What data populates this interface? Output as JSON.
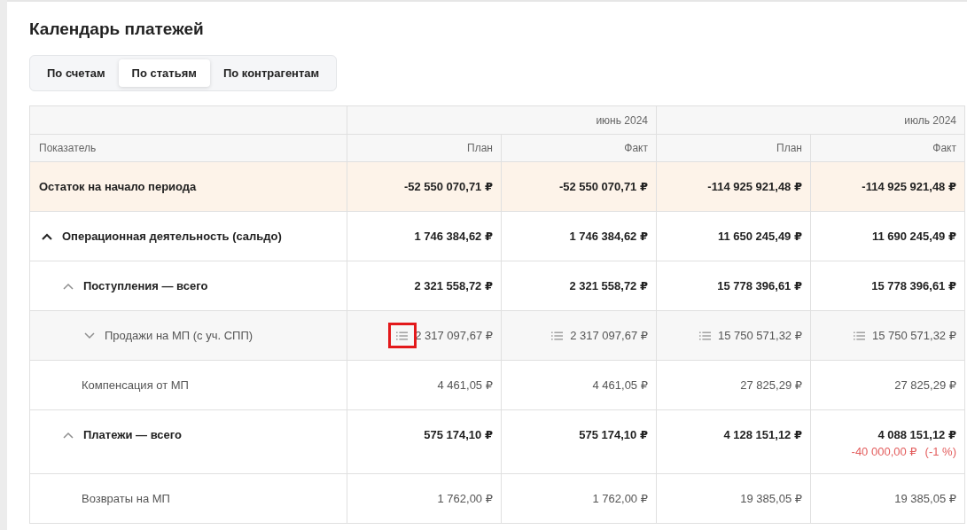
{
  "page": {
    "title": "Календарь платежей"
  },
  "tabs": [
    {
      "label": "По счетам",
      "selected": false
    },
    {
      "label": "По статьям",
      "selected": true
    },
    {
      "label": "По контрагентам",
      "selected": false
    }
  ],
  "table": {
    "header_label": "Показатель",
    "periods": [
      {
        "label": "июнь 2024",
        "columns": [
          "План",
          "Факт"
        ]
      },
      {
        "label": "июль 2024",
        "columns": [
          "План",
          "Факт"
        ]
      }
    ],
    "rows": [
      {
        "kind": "balance",
        "label": "Остаток на начало периода",
        "values": [
          {
            "text": "-52 550 070,71 ₽"
          },
          {
            "text": "-52 550 070,71 ₽"
          },
          {
            "text": "-114 925 921,48 ₽"
          },
          {
            "text": "-114 925 921,48 ₽"
          }
        ]
      },
      {
        "kind": "group",
        "label": "Операционная деятельность (сальдо)",
        "expanded": true,
        "values": [
          {
            "text": "1 746 384,62 ₽"
          },
          {
            "text": "1 746 384,62 ₽"
          },
          {
            "text": "11 650 245,49 ₽"
          },
          {
            "text": "11 690 245,49 ₽"
          }
        ],
        "children": [
          {
            "kind": "group",
            "label": "Поступления — всего",
            "expanded": true,
            "values": [
              {
                "text": "2 321 558,72 ₽"
              },
              {
                "text": "2 321 558,72 ₽"
              },
              {
                "text": "15 778 396,61 ₽"
              },
              {
                "text": "15 778 396,61 ₽"
              }
            ],
            "children": [
              {
                "kind": "item",
                "label": "Продажи на МП (с уч. СПП)",
                "expanded": false,
                "highlighted": true,
                "details": true,
                "values": [
                  {
                    "text": "2 317 097,67 ₽",
                    "framed": true
                  },
                  {
                    "text": "2 317 097,67 ₽",
                    "framed": false
                  },
                  {
                    "text": "15 750 571,32 ₽",
                    "framed": false
                  },
                  {
                    "text": "15 750 571,32 ₽",
                    "framed": false
                  }
                ]
              },
              {
                "kind": "item",
                "label": "Компенсация от МП",
                "values": [
                  {
                    "text": "4 461,05 ₽"
                  },
                  {
                    "text": "4 461,05 ₽"
                  },
                  {
                    "text": "27 825,29 ₽"
                  },
                  {
                    "text": "27 825,29 ₽"
                  }
                ]
              }
            ]
          },
          {
            "kind": "group",
            "label": "Платежи — всего",
            "expanded": true,
            "values": [
              {
                "text": "575 174,10 ₽"
              },
              {
                "text": "575 174,10 ₽"
              },
              {
                "text": "4 128 151,12 ₽"
              },
              {
                "text": "4 088 151,12 ₽",
                "delta": "-40 000,00 ₽",
                "delta_percent": "(-1 %)"
              }
            ],
            "children": [
              {
                "kind": "item",
                "label": "Возвраты на МП",
                "values": [
                  {
                    "text": "1 762,00 ₽"
                  },
                  {
                    "text": "1 762,00 ₽"
                  },
                  {
                    "text": "19 385,05 ₽"
                  },
                  {
                    "text": "19 385,05 ₽"
                  }
                ]
              }
            ]
          }
        ]
      }
    ]
  }
}
